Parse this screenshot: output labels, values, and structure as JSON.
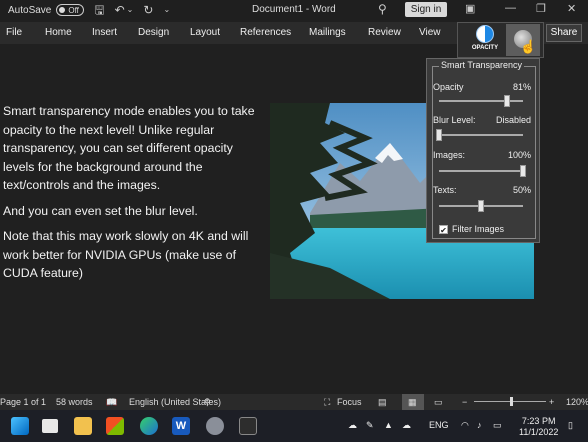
{
  "titlebar": {
    "autosave_label": "AutoSave",
    "autosave_state": "Off",
    "document_title": "Document1 - Word",
    "signin_label": "Sign in"
  },
  "ribbon": {
    "tabs": [
      "File",
      "Home",
      "Insert",
      "Design",
      "Layout",
      "References",
      "Mailings",
      "Review",
      "View"
    ],
    "opacity_button_label": "OPACITY",
    "share_label": "Share"
  },
  "document": {
    "paragraphs": [
      "Smart transparency mode enables you to take opacity to the next level! Unlike regular transparency, you can set different opacity levels for the background around the text/controls and the images.",
      "And you can even set the blur level.",
      "Note that this may work slowly on 4K and will work better for NVIDIA GPUs (make use of CUDA feature)"
    ]
  },
  "panel": {
    "title": "Smart Transparency",
    "sliders": [
      {
        "label": "Opacity",
        "value_text": "81%",
        "value": 0.81
      },
      {
        "label": "Blur Level:",
        "value_text": "Disabled",
        "value": 0.0
      },
      {
        "label": "Images:",
        "value_text": "100%",
        "value": 1.0
      },
      {
        "label": "Texts:",
        "value_text": "50%",
        "value": 0.5
      }
    ],
    "filter_label": "Filter Images",
    "filter_checked": true
  },
  "statusbar": {
    "page": "Page 1 of 1",
    "words": "58 words",
    "language": "English (United States)",
    "focus": "Focus",
    "zoom": "120%"
  },
  "taskbar": {
    "language": "ENG",
    "time": "7:23 PM",
    "date": "11/1/2022"
  },
  "colors": {
    "background": "#202020",
    "ribbon": "#2b2b2b",
    "panel": "#3a3a3a",
    "taskbar": "#1d1f26",
    "opacity_accent": "#1e88e5"
  }
}
